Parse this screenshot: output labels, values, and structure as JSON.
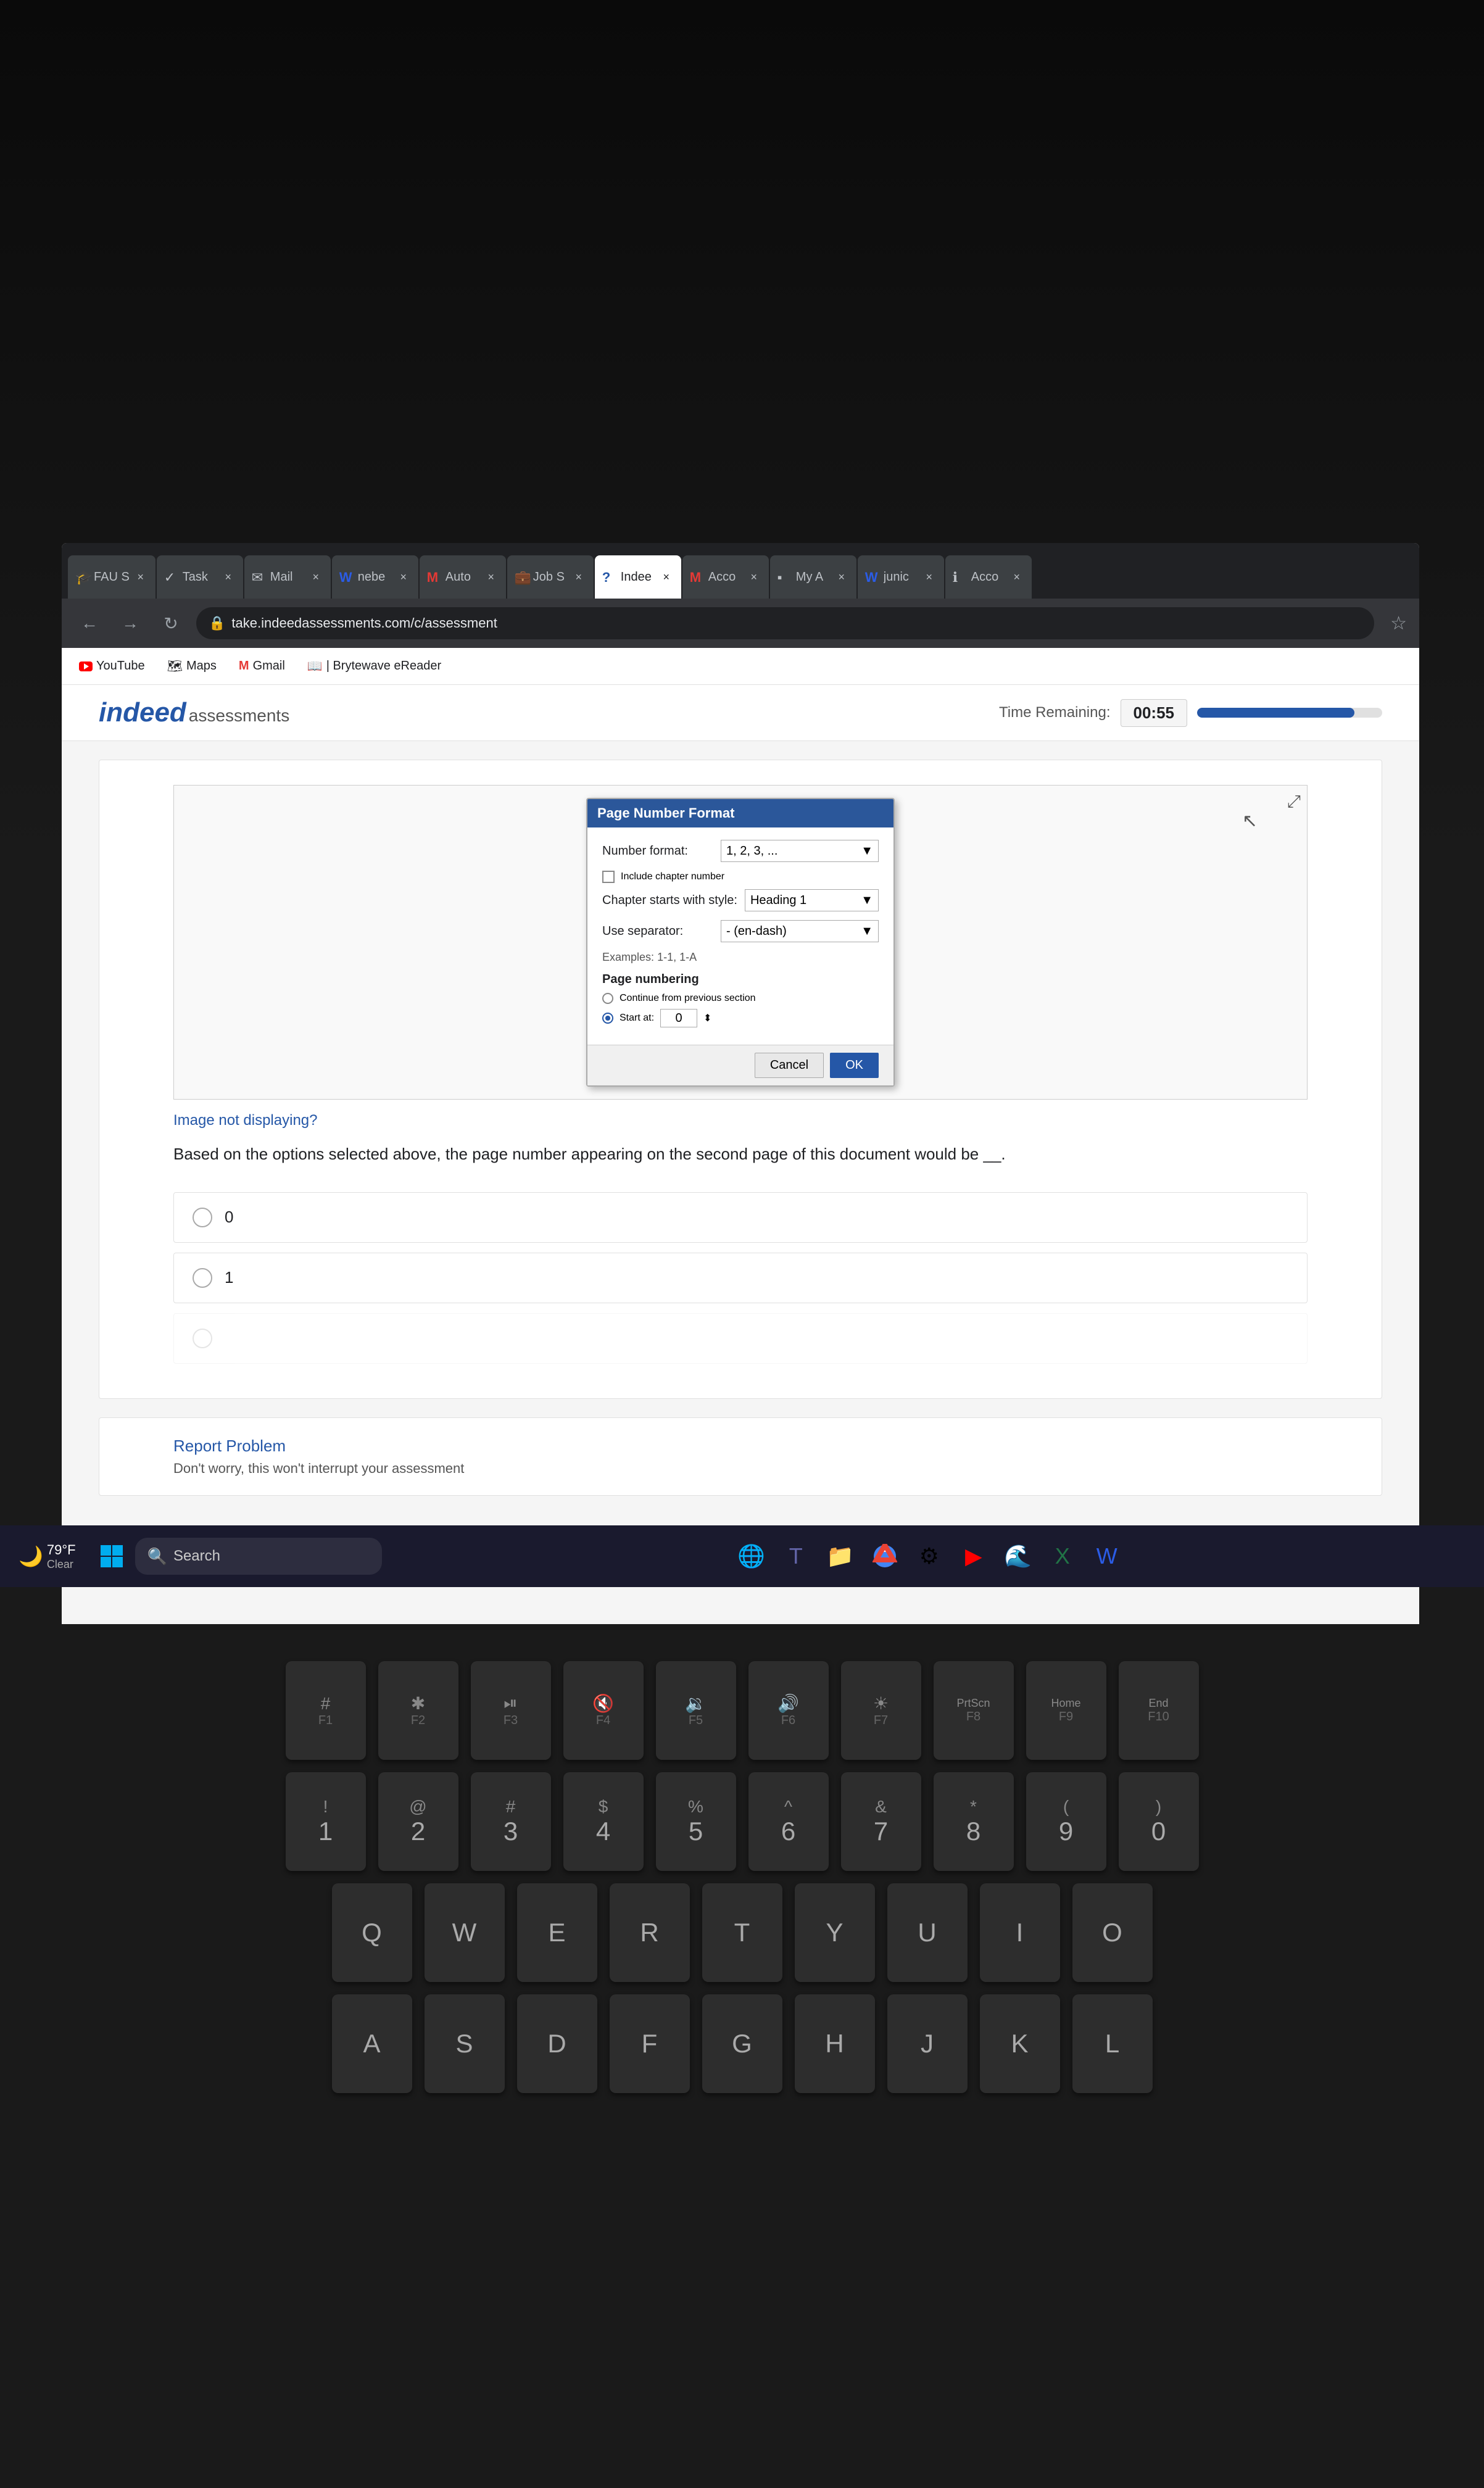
{
  "laptop": {
    "bg_color": "#1a1a1a"
  },
  "browser": {
    "tabs": [
      {
        "id": "fau",
        "label": "FAU S",
        "favicon": "🎓",
        "active": false
      },
      {
        "id": "task",
        "label": "Task",
        "favicon": "✓",
        "active": false
      },
      {
        "id": "mail",
        "label": "Mail",
        "favicon": "✉",
        "active": false
      },
      {
        "id": "nebe",
        "label": "nebe",
        "favicon": "W",
        "active": false
      },
      {
        "id": "auto",
        "label": "Auto",
        "favicon": "M",
        "active": false
      },
      {
        "id": "jobs",
        "label": "Job S",
        "favicon": "💼",
        "active": false
      },
      {
        "id": "indeed",
        "label": "Indee",
        "favicon": "?",
        "active": true
      },
      {
        "id": "acco1",
        "label": "Acco",
        "favicon": "M",
        "active": false
      },
      {
        "id": "mya",
        "label": "My A",
        "favicon": "▪",
        "active": false
      },
      {
        "id": "junic",
        "label": "junic",
        "favicon": "W",
        "active": false
      },
      {
        "id": "acco2",
        "label": "Acco",
        "favicon": "ℹ",
        "active": false
      }
    ],
    "address": "take.indeedassessments.com/c/assessment",
    "bookmarks": [
      {
        "label": "YouTube",
        "favicon": "yt"
      },
      {
        "label": "Maps",
        "favicon": "🗺"
      },
      {
        "label": "Gmail",
        "favicon": "M"
      },
      {
        "label": "| Brytewave eReader",
        "favicon": "📖"
      }
    ]
  },
  "indeed": {
    "logo_main": "indeed",
    "logo_dot": "",
    "logo_sub": "assessments",
    "timer_label": "Time Remaining:",
    "timer_value": "00:55",
    "progress_percent": 85
  },
  "dialog": {
    "title": "Page Number Format",
    "number_format_label": "Number format:",
    "number_format_value": "1, 2, 3, ...",
    "include_chapter_label": "Include chapter number",
    "chapter_style_label": "Chapter starts with style:",
    "chapter_style_value": "Heading 1",
    "separator_label": "Use separator:",
    "separator_value": "- (en-dash)",
    "examples_label": "Examples:",
    "examples_value": "1-1, 1-A",
    "page_numbering_label": "Page numbering",
    "continue_label": "Continue from previous section",
    "start_at_label": "Start at:",
    "start_at_value": "0",
    "cancel_btn": "Cancel",
    "ok_btn": "OK"
  },
  "question": {
    "image_not_displaying": "Image not displaying?",
    "question_text": "Based on the options selected above, the page number appearing on the second page of this document would be __.",
    "options": [
      {
        "value": "0",
        "label": "0"
      },
      {
        "value": "1",
        "label": "1"
      }
    ]
  },
  "report": {
    "link_text": "Report Problem",
    "note_text": "Don't worry, this won't interrupt your assessment"
  },
  "taskbar": {
    "weather_temp": "79°F",
    "weather_condition": "Clear",
    "search_placeholder": "Search",
    "apps": [
      "⊞",
      "🌐",
      "📁",
      "📧",
      "🔵",
      "⚙",
      "▶",
      "🌐",
      "🔷",
      "X",
      "W"
    ]
  },
  "keyboard": {
    "fn_row": [
      {
        "fn": "F1",
        "sym": "#"
      },
      {
        "fn": "F2",
        "sym": "✱"
      },
      {
        "fn": "F3",
        "sym": "▶⏸"
      },
      {
        "fn": "F4",
        "sym": "🔇"
      },
      {
        "fn": "F5",
        "sym": "🔉"
      },
      {
        "fn": "F6",
        "sym": "🔊"
      },
      {
        "fn": "F7",
        "sym": "☀"
      },
      {
        "fn": "F8",
        "sym": "PrtScn"
      },
      {
        "fn": "F9",
        "sym": "Home"
      },
      {
        "fn": "F10",
        "sym": "End"
      }
    ],
    "number_row": [
      "1",
      "2",
      "3",
      "4",
      "5",
      "6",
      "7",
      "8",
      "9",
      "0"
    ],
    "number_shift": [
      "!",
      "@",
      "#",
      "$",
      "%",
      "^",
      "&",
      "*",
      "(",
      ")"
    ],
    "qwerty_row": [
      "Q",
      "W",
      "E",
      "R",
      "T",
      "Y",
      "U",
      "I",
      "O"
    ],
    "asdf_row": [
      "A",
      "S",
      "D",
      "F",
      "G",
      "H",
      "J",
      "K",
      "L"
    ]
  }
}
